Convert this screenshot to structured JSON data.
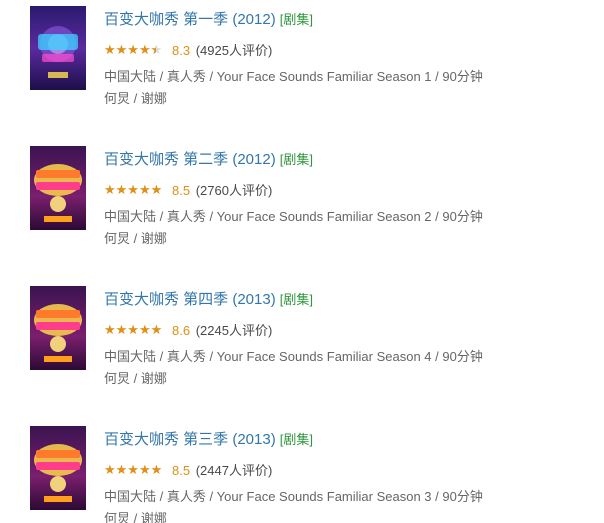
{
  "results": [
    {
      "title": "百变大咖秀 第一季 (2012)",
      "tag": "[剧集]",
      "rating": 8.3,
      "rating_text": "8.3",
      "votes": "(4925人评价)",
      "meta": "中国大陆 / 真人秀 / Your Face Sounds Familiar Season 1 / 90分钟",
      "cast": "何炅 / 谢娜",
      "poster_icon": "season-1-poster"
    },
    {
      "title": "百变大咖秀 第二季 (2012)",
      "tag": "[剧集]",
      "rating": 8.5,
      "rating_text": "8.5",
      "votes": "(2760人评价)",
      "meta": "中国大陆 / 真人秀 / Your Face Sounds Familiar Season 2 / 90分钟",
      "cast": "何炅 / 谢娜",
      "poster_icon": "season-2-poster"
    },
    {
      "title": "百变大咖秀 第四季 (2013)",
      "tag": "[剧集]",
      "rating": 8.6,
      "rating_text": "8.6",
      "votes": "(2245人评价)",
      "meta": "中国大陆 / 真人秀 / Your Face Sounds Familiar Season 4 / 90分钟",
      "cast": "何炅 / 谢娜",
      "poster_icon": "season-4-poster"
    },
    {
      "title": "百变大咖秀 第三季 (2013)",
      "tag": "[剧集]",
      "rating": 8.5,
      "rating_text": "8.5",
      "votes": "(2447人评价)",
      "meta": "中国大陆 / 真人秀 / Your Face Sounds Familiar Season 3 / 90分钟",
      "cast": "何炅 / 谢娜",
      "poster_icon": "season-3-poster"
    }
  ],
  "colors": {
    "title": "#3377aa",
    "tag": "#2e963d",
    "star": "#e09015",
    "meta": "#666666"
  }
}
